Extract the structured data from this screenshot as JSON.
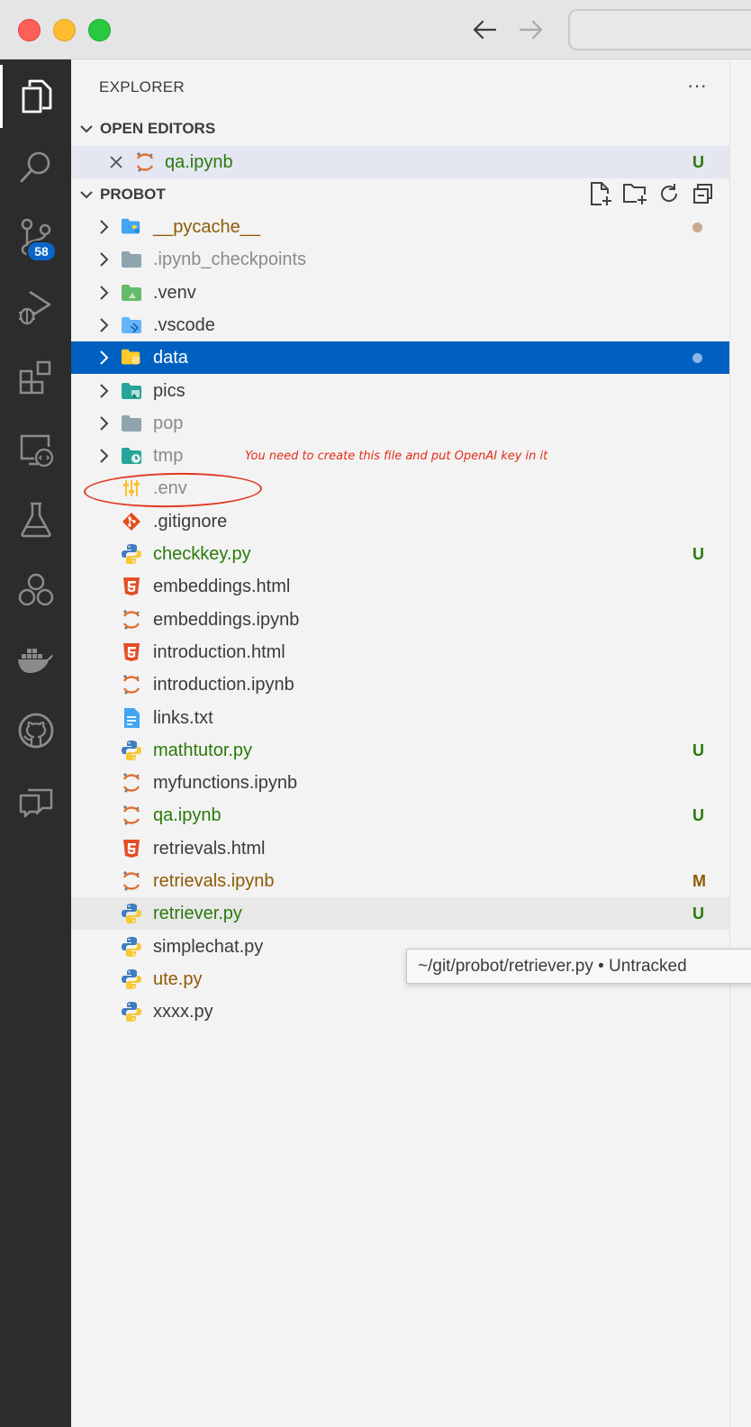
{
  "window": {
    "back_label": "←",
    "forward_label": "→"
  },
  "activity_bar": {
    "items": [
      {
        "name": "explorer-icon",
        "active": true
      },
      {
        "name": "search-icon"
      },
      {
        "name": "source-control-icon",
        "badge": "58"
      },
      {
        "name": "run-debug-icon"
      },
      {
        "name": "extensions-icon"
      },
      {
        "name": "remote-explorer-icon"
      },
      {
        "name": "testing-icon"
      },
      {
        "name": "live-share-icon"
      },
      {
        "name": "docker-icon"
      },
      {
        "name": "github-icon"
      },
      {
        "name": "comments-icon"
      }
    ]
  },
  "explorer": {
    "title": "EXPLORER",
    "more": "···",
    "open_editors": {
      "header": "OPEN EDITORS",
      "items": [
        {
          "label": "qa.ipynb",
          "status": "U",
          "icon": "jupyter-icon"
        }
      ]
    },
    "project": {
      "header": "PROBOT",
      "entries": [
        {
          "label": "__pycache__",
          "type": "folder",
          "icon": "python-folder-icon",
          "color": "brown",
          "dot": "#c9a98a"
        },
        {
          "label": ".ipynb_checkpoints",
          "type": "folder",
          "icon": "folder-icon",
          "color": "gray"
        },
        {
          "label": ".venv",
          "type": "folder",
          "icon": "venv-folder-icon",
          "color": "dark"
        },
        {
          "label": ".vscode",
          "type": "folder",
          "icon": "vscode-folder-icon",
          "color": "dark"
        },
        {
          "label": "data",
          "type": "folder",
          "icon": "data-folder-icon",
          "color": "white",
          "selected": true,
          "dot": "#8cb3e8"
        },
        {
          "label": "pics",
          "type": "folder",
          "icon": "images-folder-icon",
          "color": "dark"
        },
        {
          "label": "pop",
          "type": "folder",
          "icon": "folder-icon",
          "color": "gray"
        },
        {
          "label": "tmp",
          "type": "folder",
          "icon": "temp-folder-icon",
          "color": "gray"
        },
        {
          "label": ".env",
          "type": "file",
          "icon": "env-icon",
          "color": "gray"
        },
        {
          "label": ".gitignore",
          "type": "file",
          "icon": "git-icon",
          "color": "dark"
        },
        {
          "label": "checkkey.py",
          "type": "file",
          "icon": "python-icon",
          "color": "green",
          "status": "U"
        },
        {
          "label": "embeddings.html",
          "type": "file",
          "icon": "html5-icon",
          "color": "dark"
        },
        {
          "label": "embeddings.ipynb",
          "type": "file",
          "icon": "jupyter-icon",
          "color": "dark"
        },
        {
          "label": "introduction.html",
          "type": "file",
          "icon": "html5-icon",
          "color": "dark"
        },
        {
          "label": "introduction.ipynb",
          "type": "file",
          "icon": "jupyter-icon",
          "color": "dark"
        },
        {
          "label": "links.txt",
          "type": "file",
          "icon": "text-file-icon",
          "color": "dark"
        },
        {
          "label": "mathtutor.py",
          "type": "file",
          "icon": "python-icon",
          "color": "green",
          "status": "U"
        },
        {
          "label": "myfunctions.ipynb",
          "type": "file",
          "icon": "jupyter-icon",
          "color": "dark"
        },
        {
          "label": "qa.ipynb",
          "type": "file",
          "icon": "jupyter-icon",
          "color": "green",
          "status": "U"
        },
        {
          "label": "retrievals.html",
          "type": "file",
          "icon": "html5-icon",
          "color": "dark"
        },
        {
          "label": "retrievals.ipynb",
          "type": "file",
          "icon": "jupyter-icon",
          "color": "brown",
          "status": "M"
        },
        {
          "label": "retriever.py",
          "type": "file",
          "icon": "python-icon",
          "color": "green",
          "status": "U",
          "hover": true
        },
        {
          "label": "simplechat.py",
          "type": "file",
          "icon": "python-icon",
          "color": "dark"
        },
        {
          "label": "ute.py",
          "type": "file",
          "icon": "python-icon",
          "color": "brown"
        },
        {
          "label": "xxxx.py",
          "type": "file",
          "icon": "python-icon",
          "color": "dark"
        }
      ]
    }
  },
  "annotation": "You need to create this file and put OpenAI key in it",
  "tooltip": "~/git/probot/retriever.py • Untracked"
}
